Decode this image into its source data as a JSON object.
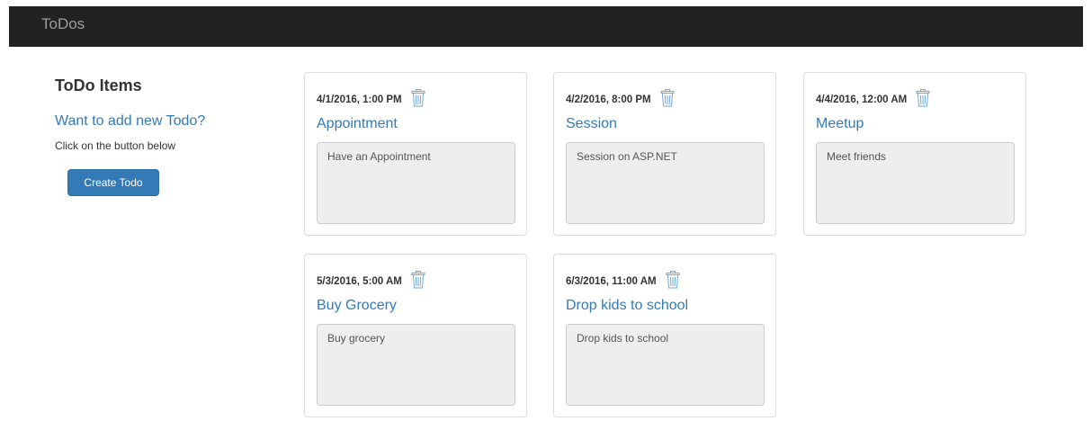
{
  "app": {
    "brand": "ToDos"
  },
  "sidebar": {
    "heading": "ToDo Items",
    "add_prompt": "Want to add new Todo?",
    "hint": "Click on the button below",
    "create_button": "Create Todo"
  },
  "todos": [
    {
      "datetime": "4/1/2016, 1:00 PM",
      "title": "Appointment",
      "description": "Have an Appointment"
    },
    {
      "datetime": "4/2/2016, 8:00 PM",
      "title": "Session",
      "description": "Session on ASP.NET"
    },
    {
      "datetime": "4/4/2016, 12:00 AM",
      "title": "Meetup",
      "description": "Meet friends"
    },
    {
      "datetime": "5/3/2016, 5:00 AM",
      "title": "Buy Grocery",
      "description": "Buy grocery"
    },
    {
      "datetime": "6/3/2016, 11:00 AM",
      "title": "Drop kids to school",
      "description": "Drop kids to school"
    }
  ],
  "icons": {
    "delete": "trash-icon"
  },
  "colors": {
    "navbar": "#222222",
    "brand_text": "#9d9d9d",
    "link": "#337ab7",
    "primary_button": "#337ab7",
    "description_bg": "#eeeeee",
    "trash_icon": "#6ea8dc"
  }
}
